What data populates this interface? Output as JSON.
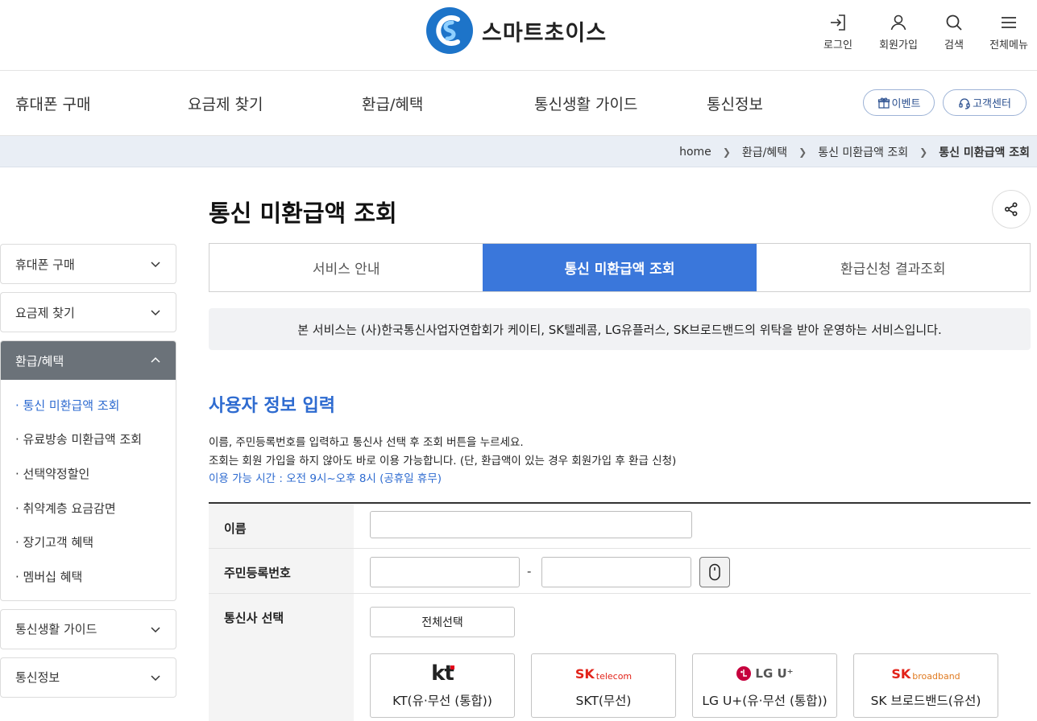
{
  "brand": {
    "name": "스마트초이스"
  },
  "util": [
    {
      "label": "로그인",
      "icon": "login-icon"
    },
    {
      "label": "회원가입",
      "icon": "user-icon"
    },
    {
      "label": "검색",
      "icon": "search-icon"
    },
    {
      "label": "전체메뉴",
      "icon": "menu-icon"
    }
  ],
  "gnb": {
    "items": [
      "휴대폰 구매",
      "요금제 찾기",
      "환급/혜택",
      "통신생활 가이드",
      "통신정보"
    ],
    "event_label": "이벤트",
    "support_label": "고객센터"
  },
  "breadcrumb": [
    "home",
    "환급/혜택",
    "통신 미환급액 조회",
    "통신 미환급액 조회"
  ],
  "sidebar": {
    "items": [
      {
        "label": "휴대폰 구매"
      },
      {
        "label": "요금제 찾기"
      },
      {
        "label": "환급/혜택"
      },
      {
        "label": "통신생활 가이드"
      },
      {
        "label": "통신정보"
      }
    ],
    "sub": [
      "· 통신 미환급액 조회",
      "· 유료방송 미환급액 조회",
      "· 선택약정할인",
      "· 취약계층 요금감면",
      "· 장기고객 혜택",
      "· 멤버십 혜택"
    ]
  },
  "page": {
    "title": "통신 미환급액 조회",
    "tabs": [
      "서비스 안내",
      "통신 미환급액 조회",
      "환급신청 결과조회"
    ],
    "notice": "본 서비스는 (사)한국통신사업자연합회가 케이티, SK텔레콤, LG유플러스, SK브로드밴드의 위탁을 받아 운영하는 서비스입니다.",
    "section_title": "사용자 정보 입력",
    "desc1": "이름, 주민등록번호를 입력하고 통신사 선택 후 조회 버튼을 누르세요.",
    "desc2": "조회는 회원 가입을 하지 않아도 바로 이용 가능합니다. (단, 환급액이 있는 경우 회원가입 후 환급 신청)",
    "desc3": "이용 가능 시간 : 오전 9시~오후 8시 (공휴일 휴무)"
  },
  "form": {
    "name_label": "이름",
    "name_value": "",
    "rrn_label": "주민등록번호",
    "rrn_sep": "-",
    "rrn1_value": "",
    "rrn2_value": "",
    "carrier_label": "통신사 선택",
    "select_all": "전체선택",
    "carriers": [
      {
        "logo": "kt",
        "name": "KT(유·무선 (통합))"
      },
      {
        "logo_main": "SK",
        "logo_sub": "telecom",
        "name": "SKT(무선)"
      },
      {
        "logo": "LG U⁺",
        "name": "LG U+(유·무선 (통합))"
      },
      {
        "logo_main": "SK",
        "logo_sub": "broadband",
        "name": "SK 브로드밴드(유선)"
      }
    ]
  },
  "colors": {
    "accent": "#3a77db",
    "sidebar_active": "#6b7279",
    "link": "#2e6bd0",
    "crumb_bg": "#e9eef5"
  }
}
